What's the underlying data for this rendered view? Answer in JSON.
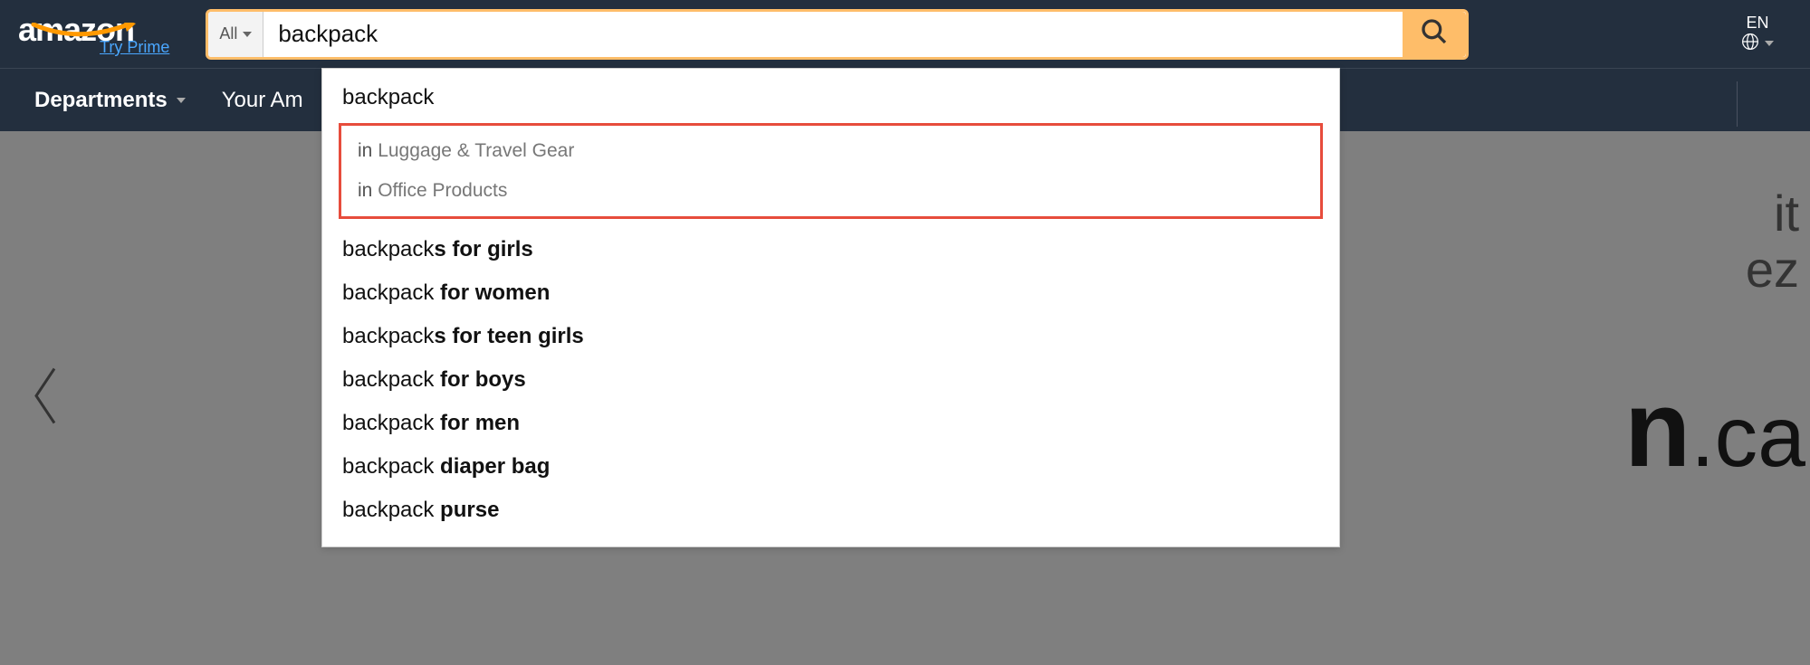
{
  "header": {
    "logo_text": "amazon",
    "try_prime": "Try Prime",
    "search_category": "All",
    "search_value": "backpack",
    "lang_code": "EN"
  },
  "subnav": {
    "departments": "Departments",
    "your_amazon": "Your Am"
  },
  "suggestions": {
    "top": "backpack",
    "categories": [
      {
        "in": "in ",
        "name": "Luggage & Travel Gear"
      },
      {
        "in": "in ",
        "name": "Office Products"
      }
    ],
    "items": [
      {
        "prefix": "backpack",
        "bold": "s for girls"
      },
      {
        "prefix": "backpack",
        "bold": " for women"
      },
      {
        "prefix": "backpack",
        "bold": "s for teen girls"
      },
      {
        "prefix": "backpack",
        "bold": " for boys"
      },
      {
        "prefix": "backpack",
        "bold": " for men"
      },
      {
        "prefix": "backpack",
        "bold": " diaper bag"
      },
      {
        "prefix": "backpack",
        "bold": " purse"
      }
    ]
  },
  "background": {
    "line1": "it",
    "line2": "ez",
    "brand_part": "n",
    "brand_suffix": ".ca"
  }
}
